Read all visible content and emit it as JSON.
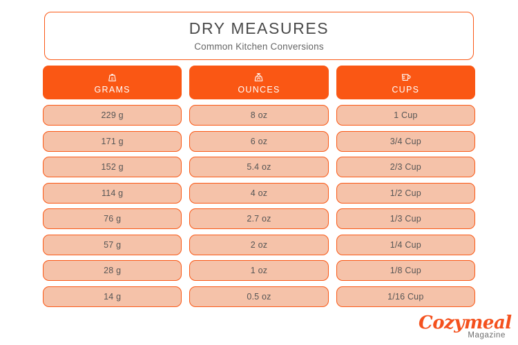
{
  "header": {
    "title": "DRY MEASURES",
    "subtitle": "Common Kitchen Conversions"
  },
  "colors": {
    "accent_orange": "#FA5714",
    "cell_fill": "#F5C2A9",
    "title_text": "#4A4A4A",
    "subtitle_text": "#666666",
    "cell_text": "#555555",
    "logo_orange": "#F4511E",
    "background": "#FFFFFF"
  },
  "table": {
    "columns": [
      {
        "label": "GRAMS",
        "icon": "weight-icon"
      },
      {
        "label": "OUNCES",
        "icon": "kitchen-scale-icon"
      },
      {
        "label": "CUPS",
        "icon": "measuring-cup-icon"
      }
    ],
    "rows": [
      {
        "grams": "229 g",
        "ounces": "8 oz",
        "cups": "1 Cup"
      },
      {
        "grams": "171 g",
        "ounces": "6 oz",
        "cups": "3/4 Cup"
      },
      {
        "grams": "152 g",
        "ounces": "5.4 oz",
        "cups": "2/3 Cup"
      },
      {
        "grams": "114 g",
        "ounces": "4 oz",
        "cups": "1/2 Cup"
      },
      {
        "grams": "76 g",
        "ounces": "2.7 oz",
        "cups": "1/3 Cup"
      },
      {
        "grams": "57 g",
        "ounces": "2 oz",
        "cups": "1/4 Cup"
      },
      {
        "grams": "28 g",
        "ounces": "1 oz",
        "cups": "1/8 Cup"
      },
      {
        "grams": "14 g",
        "ounces": "0.5 oz",
        "cups": "1/16 Cup"
      }
    ]
  },
  "logo": {
    "brand": "Cozymeal",
    "tagline": "Magazine"
  }
}
